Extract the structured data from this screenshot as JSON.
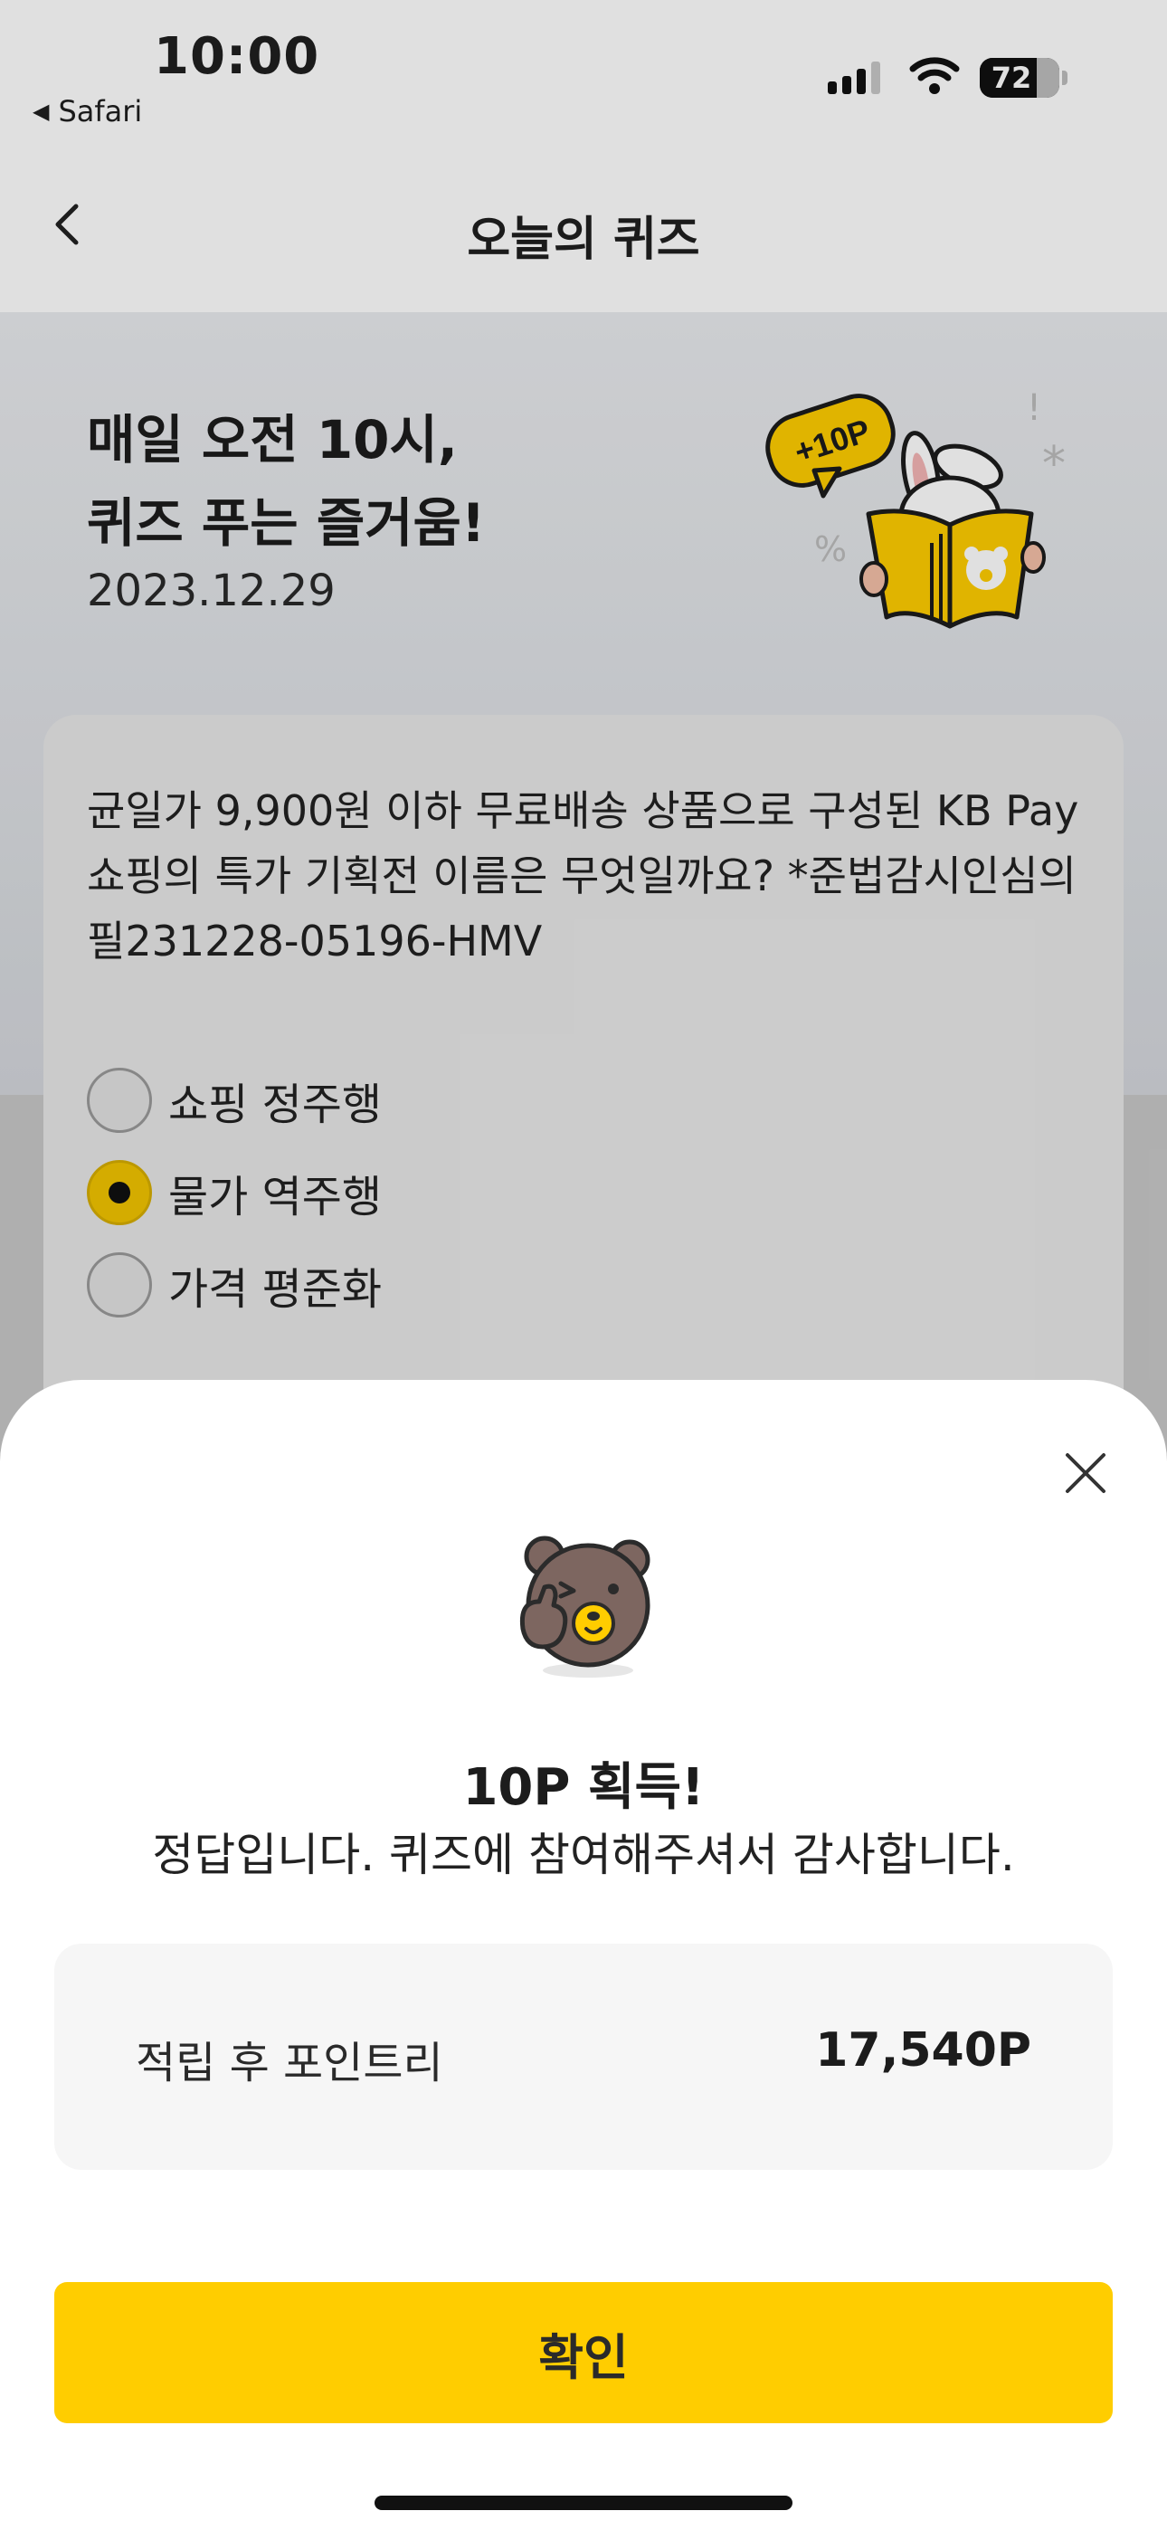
{
  "status_bar": {
    "time": "10:00",
    "back_app": "Safari",
    "battery_percent": "72",
    "battery_level": 72
  },
  "nav": {
    "title": "오늘의 퀴즈"
  },
  "hero": {
    "title_line1": "매일 오전 10시,",
    "title_line2": "퀴즈 푸는 즐거움!",
    "date": "2023.12.29",
    "badge": "+10P"
  },
  "quiz": {
    "question_line1": "균일가 9,900원 이하 무료배송 상품으로 구성된 KB Pay",
    "question_line2": "쇼핑의 특가 기획전 이름은 무엇일까요? *준법감시인심의",
    "question_line3": "필231228-05196-HMV",
    "options": [
      {
        "label": "쇼핑 정주행",
        "selected": false
      },
      {
        "label": "물가 역주행",
        "selected": true
      },
      {
        "label": "가격 평준화",
        "selected": false
      }
    ]
  },
  "result_sheet": {
    "title": "10P 획득!",
    "message": "정답입니다. 퀴즈에 참여해주셔서 감사합니다.",
    "points_label": "적립 후 포인트리",
    "points_value": "17,540P",
    "confirm_label": "확인"
  },
  "colors": {
    "accent_yellow": "#ffcd00",
    "selected_radio": "#f2c400",
    "hero_top": "#e9ebee",
    "hero_bottom": "#d4d7dc"
  }
}
